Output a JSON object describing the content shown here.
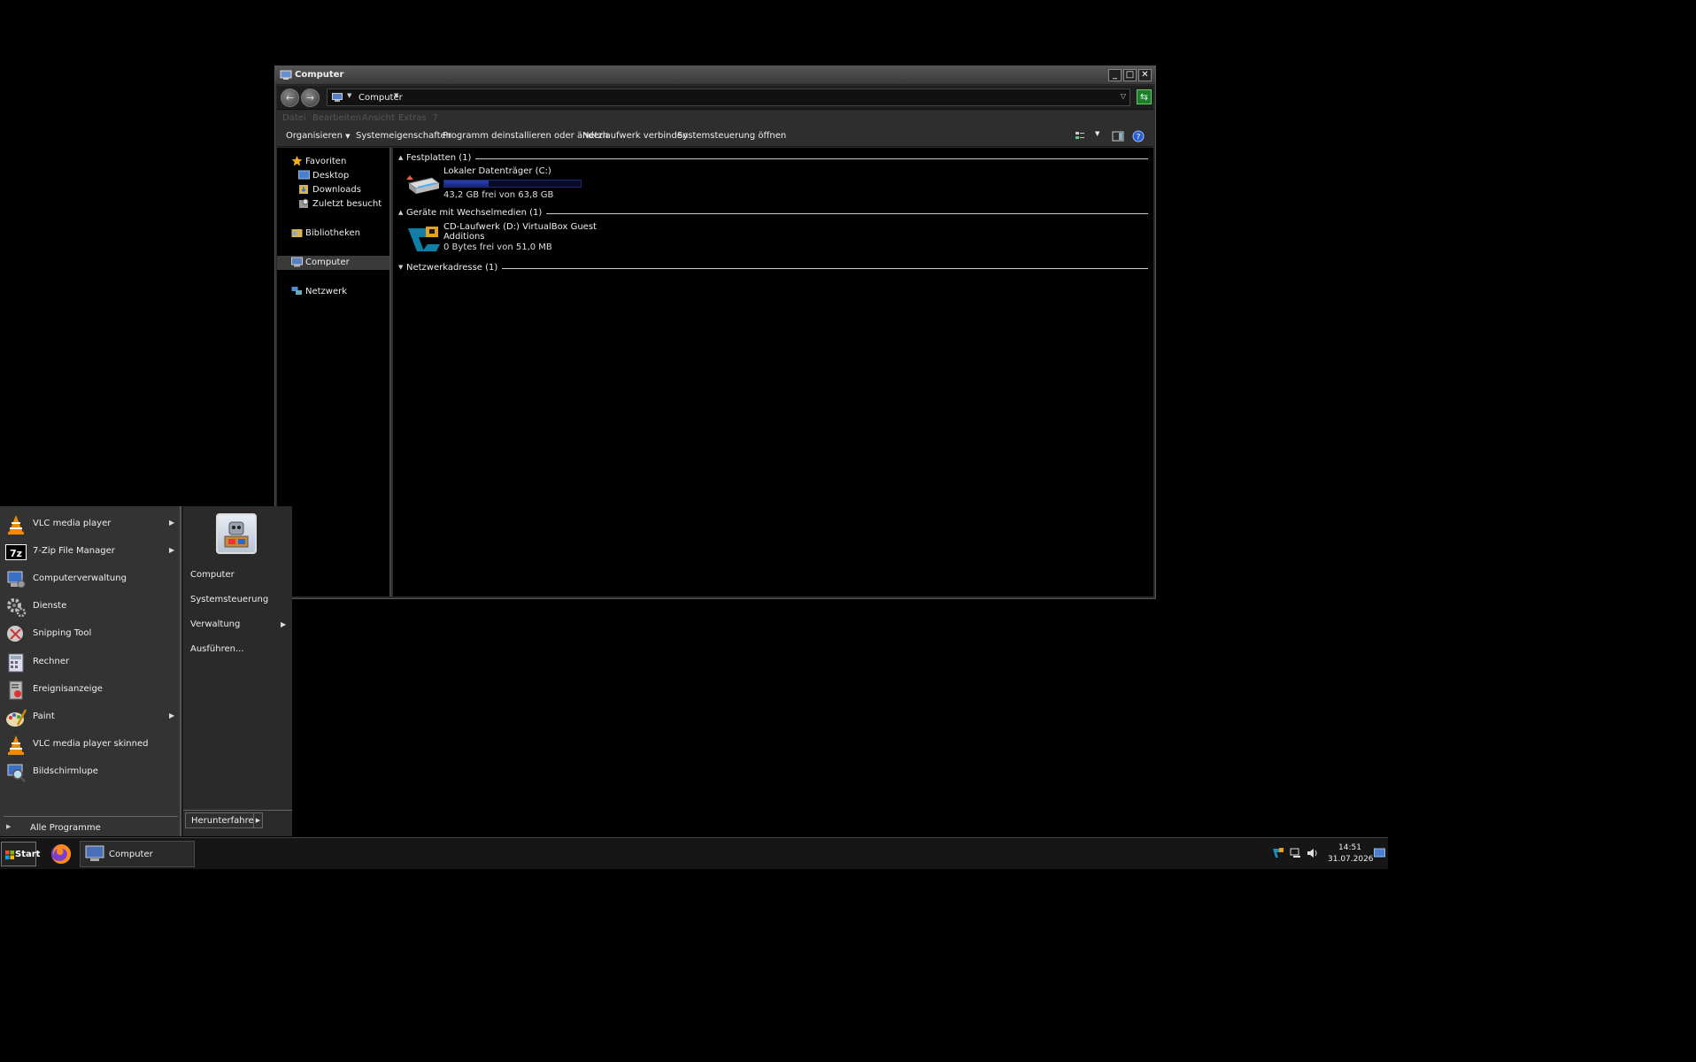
{
  "window": {
    "title": "Computer",
    "address": "Computer",
    "menu": [
      "Datei",
      "Bearbeiten",
      "Ansicht",
      "Extras",
      "?"
    ],
    "commands": {
      "organize": "Organisieren",
      "system_properties": "Systemeigenschaften",
      "uninstall": "Programm deinstallieren oder ändern",
      "map_drive": "Netzlaufwerk verbinden",
      "control_panel": "Systemsteuerung öffnen"
    },
    "nav": {
      "favorites": "Favoriten",
      "desktop": "Desktop",
      "downloads": "Downloads",
      "recent": "Zuletzt besucht",
      "libraries": "Bibliotheken",
      "computer": "Computer",
      "network": "Netzwerk"
    },
    "groups": {
      "hdd": "Festplatten (1)",
      "removable": "Geräte mit Wechselmedien (1)",
      "network": "Netzwerkadresse (1)"
    },
    "drive_c": {
      "name": "Lokaler Datenträger (C:)",
      "free": "43,2 GB frei von 63,8 GB",
      "used_fraction": 0.323
    },
    "drive_d": {
      "name_line1": "CD-Laufwerk (D:) VirtualBox Guest",
      "name_line2": "Additions",
      "free": "0 Bytes frei von 51,0 MB"
    }
  },
  "start_menu": {
    "programs": [
      {
        "label": "VLC media player",
        "icon": "vlc-icon",
        "submenu": true
      },
      {
        "label": "7-Zip File Manager",
        "icon": "7zip-icon",
        "submenu": true
      },
      {
        "label": "Computerverwaltung",
        "icon": "computer-management-icon",
        "submenu": false
      },
      {
        "label": "Dienste",
        "icon": "services-gear-icon",
        "submenu": false
      },
      {
        "label": "Snipping Tool",
        "icon": "snipping-tool-icon",
        "submenu": false
      },
      {
        "label": "Rechner",
        "icon": "calculator-icon",
        "submenu": false
      },
      {
        "label": "Ereignisanzeige",
        "icon": "event-viewer-icon",
        "submenu": false
      },
      {
        "label": "Paint",
        "icon": "paint-icon",
        "submenu": true
      },
      {
        "label": "VLC media player skinned",
        "icon": "vlc-icon",
        "submenu": false
      },
      {
        "label": "Bildschirmlupe",
        "icon": "magnifier-icon",
        "submenu": false
      }
    ],
    "all_programs": "Alle Programme",
    "right": {
      "computer": "Computer",
      "control_panel": "Systemsteuerung",
      "admin": "Verwaltung",
      "run": "Ausführen..."
    },
    "shutdown": "Herunterfahren"
  },
  "taskbar": {
    "start": "Start",
    "window_button": "Computer",
    "time": "14:51",
    "date": "31.07.2026"
  }
}
